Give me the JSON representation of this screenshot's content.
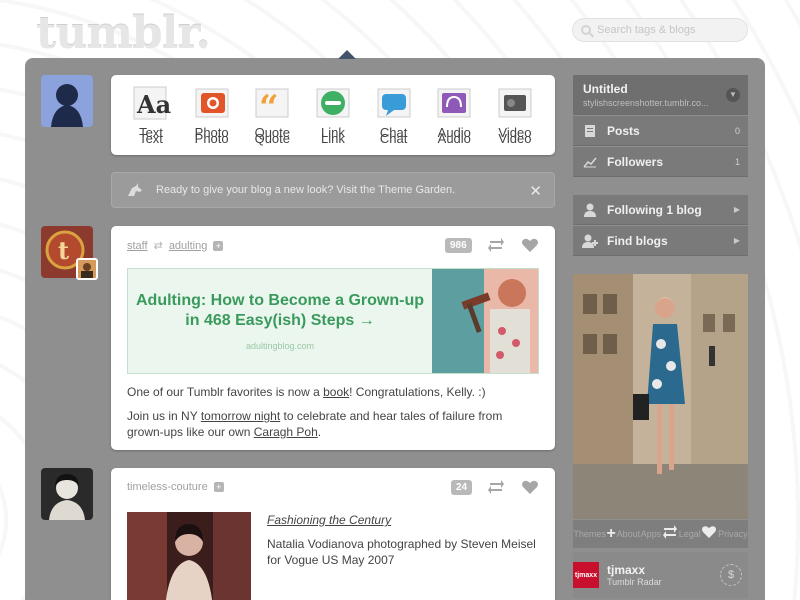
{
  "header": {
    "logo": "tumblr.",
    "search_placeholder": "Search tags & blogs"
  },
  "composer": {
    "post_types": [
      {
        "label": "Text",
        "icon": "text-icon"
      },
      {
        "label": "Photo",
        "icon": "camera-icon"
      },
      {
        "label": "Quote",
        "icon": "quote-icon"
      },
      {
        "label": "Link",
        "icon": "link-icon"
      },
      {
        "label": "Chat",
        "icon": "chat-icon"
      },
      {
        "label": "Audio",
        "icon": "headphones-icon"
      },
      {
        "label": "Video",
        "icon": "video-camera-icon"
      }
    ]
  },
  "theme_banner": {
    "text": "Ready to give your blog a new look? Visit the Theme Garden."
  },
  "post1": {
    "author": "staff",
    "reblogged_from": "adulting",
    "notes": "986",
    "link_title": "Adulting: How to Become a Grown-up in 468 Easy(ish) Steps →",
    "link_domain": "adultingblog.com",
    "body_line1_pre": "One of our Tumblr favorites is now a ",
    "body_line1_link": "book",
    "body_line1_post": "! Congratulations, Kelly. :)",
    "body_line2_pre": "Join us in NY ",
    "body_line2_link": "tomorrow night",
    "body_line2_mid": " to celebrate and hear tales of failure from grown-ups like our own ",
    "body_line2_link2": "Caragh Poh",
    "body_line2_post": "."
  },
  "post2": {
    "author": "timeless-couture",
    "notes": "24",
    "caption_title": "Fashioning the Century",
    "caption_body": "Natalia Vodianova photographed by Steven Meisel for Vogue US May 2007"
  },
  "sidebar": {
    "blog_title": "Untitled",
    "blog_url": "stylishscreenshotter.tumblr.co...",
    "posts_label": "Posts",
    "posts_count": "0",
    "followers_label": "Followers",
    "followers_count": "1",
    "following_label": "Following 1 blog",
    "find_label": "Find blogs",
    "footer_links": [
      "Themes",
      "About",
      "Apps",
      "Legal",
      "Privacy"
    ],
    "radar_blog": "tjmaxx",
    "radar_label": "Tumblr Radar",
    "radar_logo": "tjmaxx"
  },
  "colors": {
    "dashboard_bg": "#8f8f8f",
    "link_green": "#3a9a5c",
    "sidebar_row": "#7a7a7a"
  }
}
